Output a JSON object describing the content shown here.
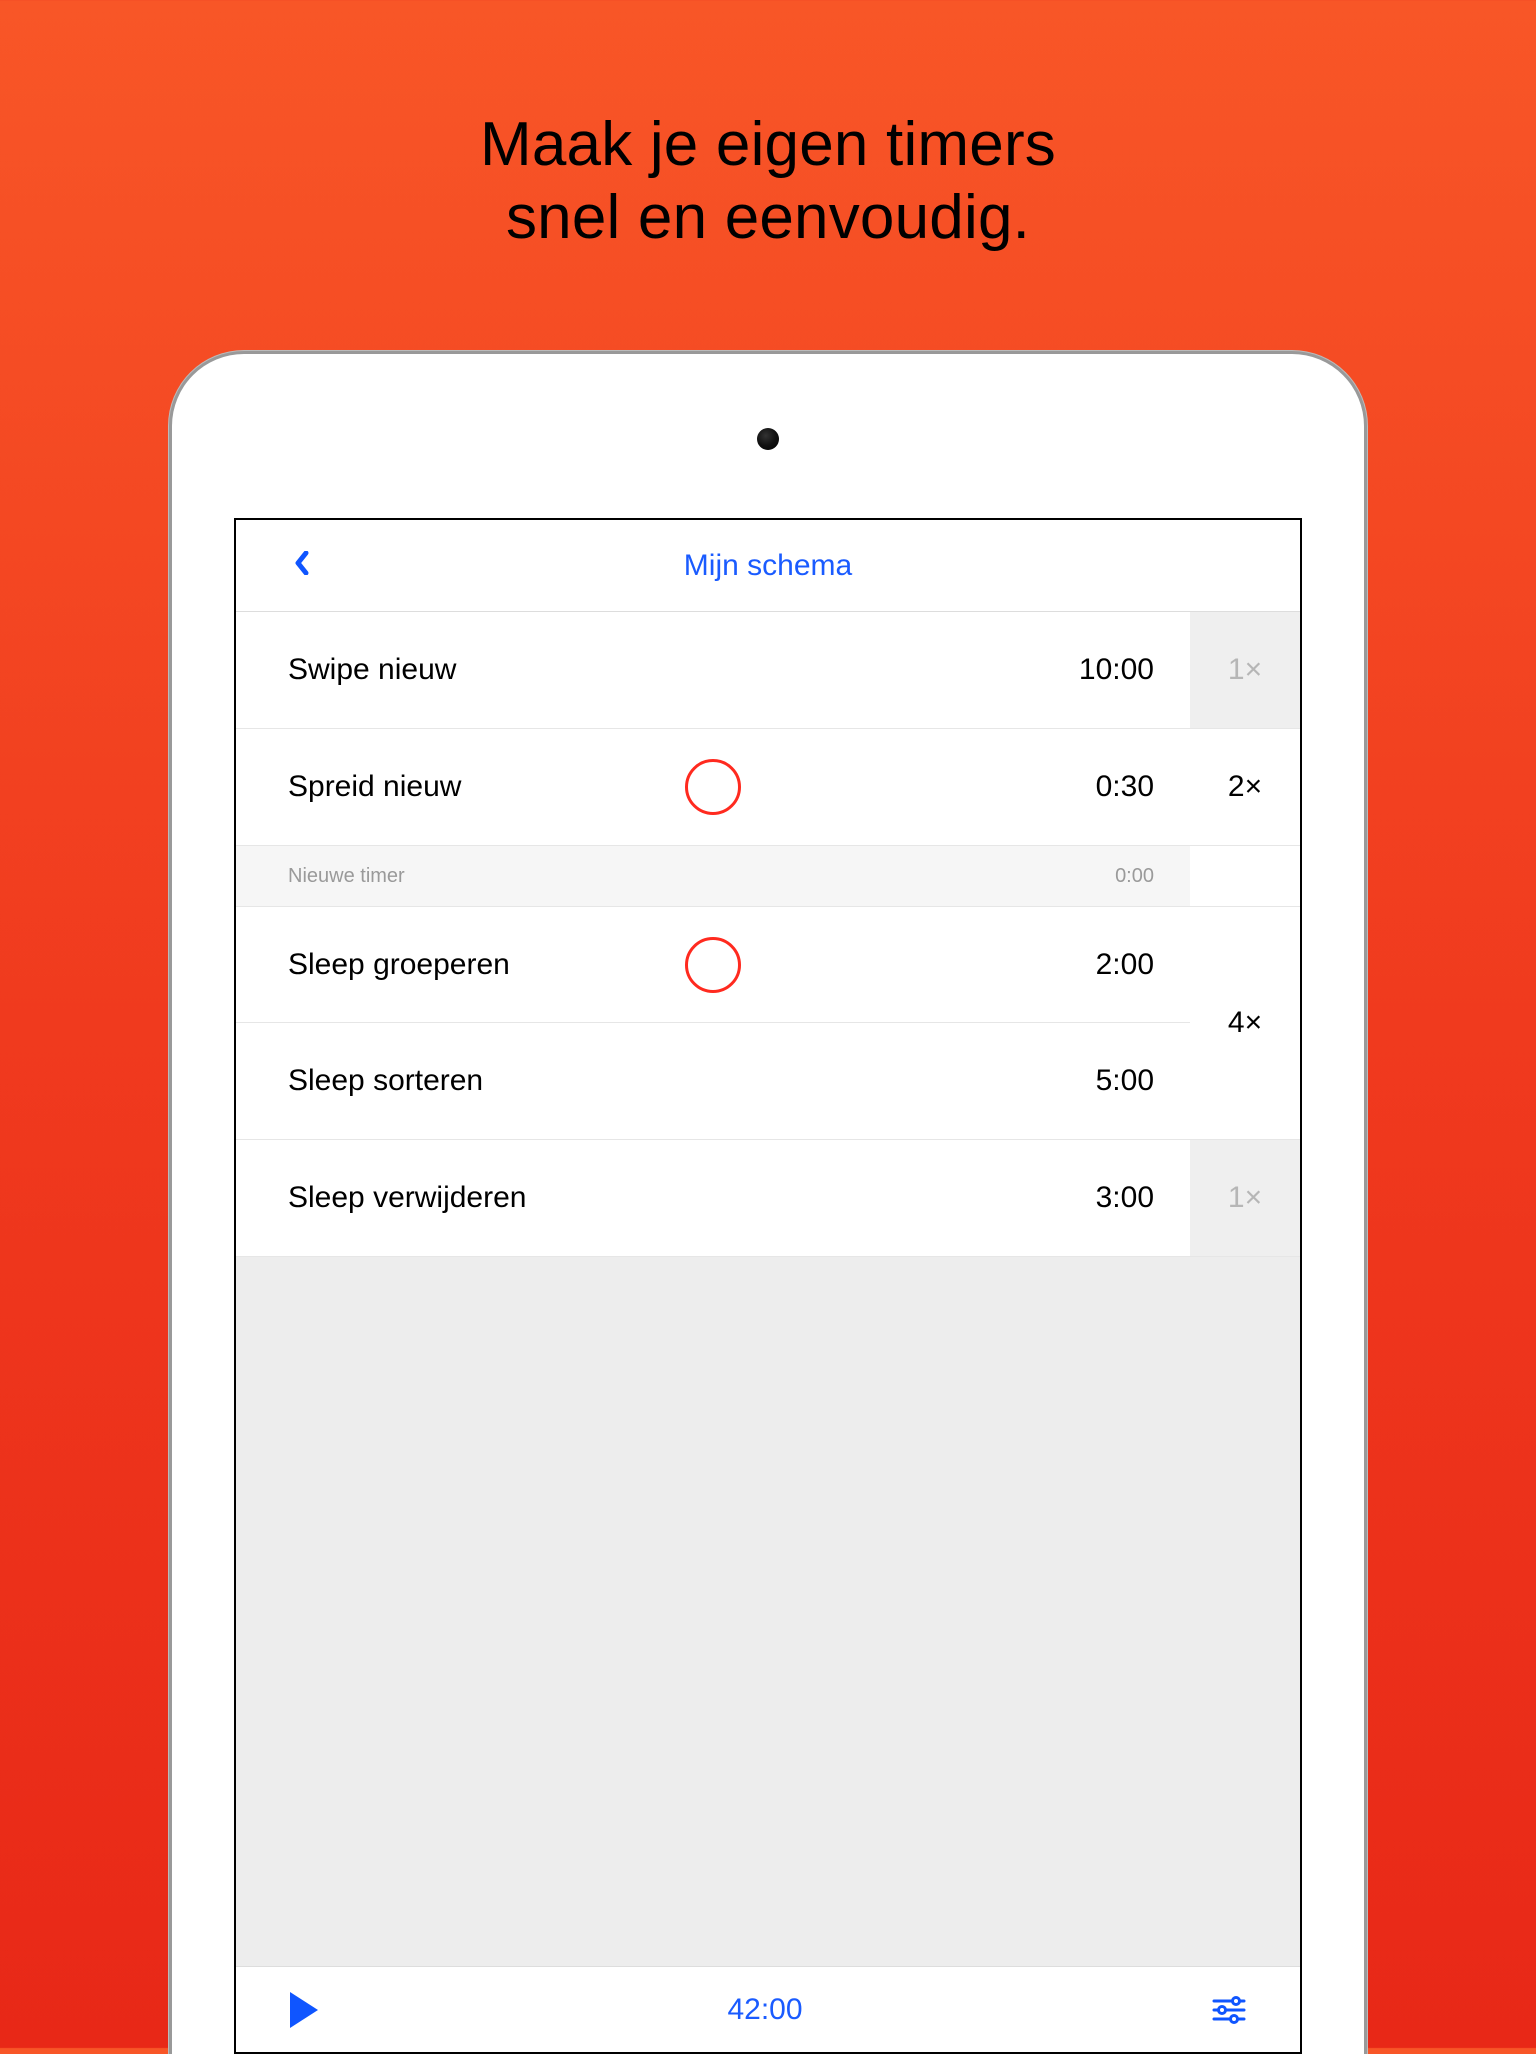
{
  "headline": {
    "line1": "Maak je eigen timers",
    "line2": "snel en eenvoudig."
  },
  "nav": {
    "title": "Mijn schema"
  },
  "rows": {
    "r1": {
      "name": "Swipe nieuw",
      "time": "10:00",
      "mult": "1×"
    },
    "r2": {
      "name": "Spreid nieuw",
      "time": "0:30",
      "mult": "2×"
    },
    "r3": {
      "name": "Nieuwe timer",
      "time": "0:00"
    },
    "r4": {
      "name": "Sleep groeperen",
      "time": "2:00"
    },
    "r5": {
      "name": "Sleep sorteren",
      "time": "5:00"
    },
    "mult45": "4×",
    "r6": {
      "name": "Sleep verwijderen",
      "time": "3:00",
      "mult": "1×"
    }
  },
  "footer": {
    "total": "42:00"
  }
}
